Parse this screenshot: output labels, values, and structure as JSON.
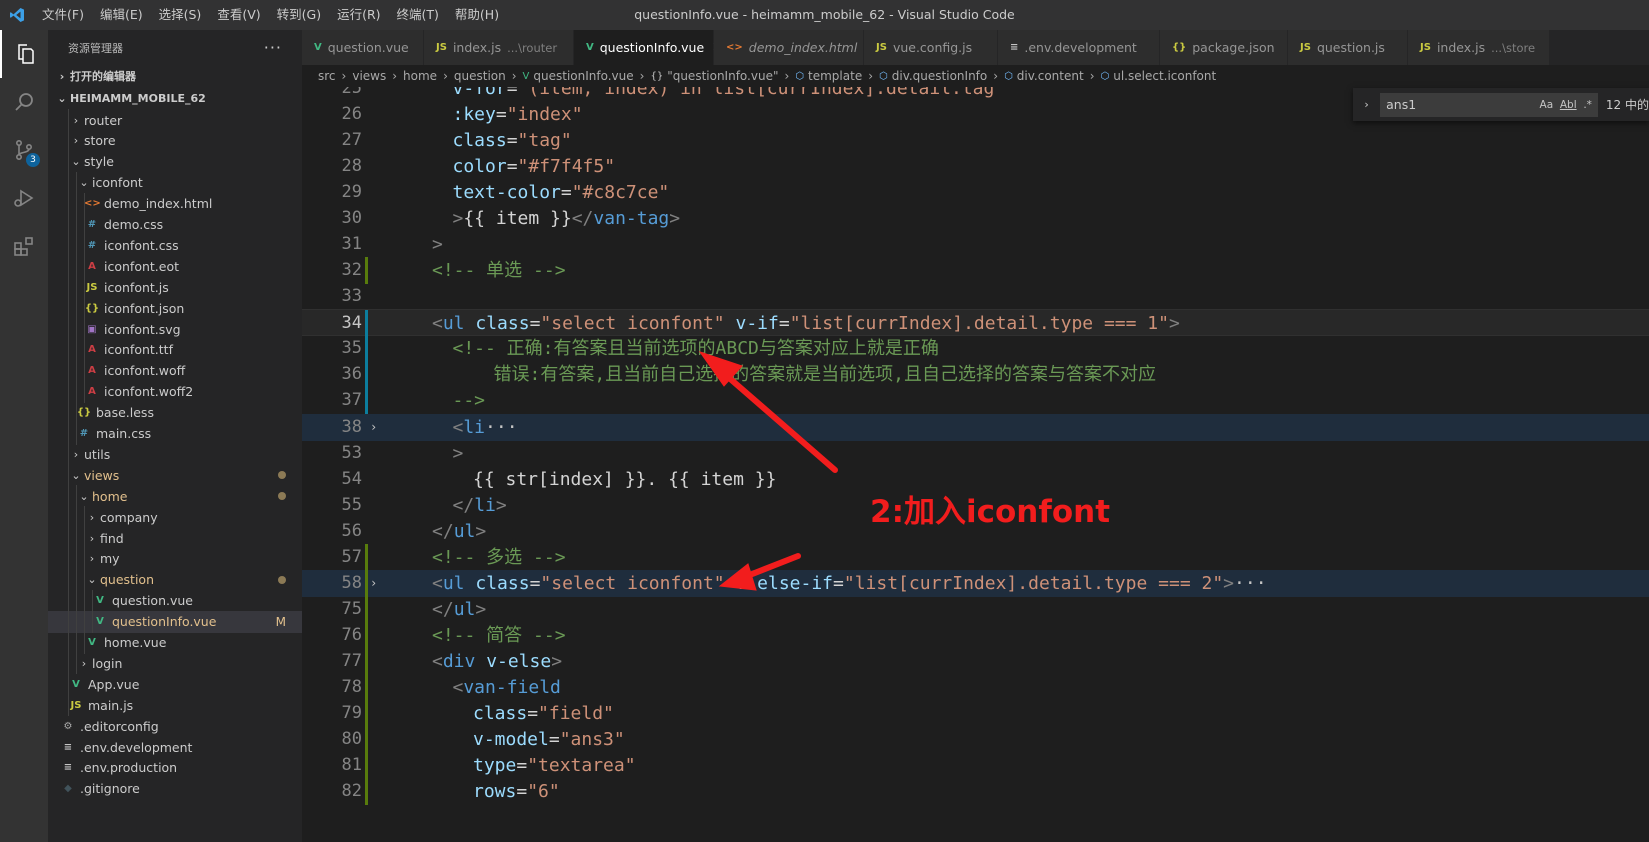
{
  "window": {
    "title": "questionInfo.vue - heimamm_mobile_62 - Visual Studio Code",
    "menu": [
      "文件(F)",
      "编辑(E)",
      "选择(S)",
      "查看(V)",
      "转到(G)",
      "运行(R)",
      "终端(T)",
      "帮助(H)"
    ]
  },
  "activity": {
    "scm_badge": "3"
  },
  "sidebar": {
    "title": "资源管理器",
    "more": "···",
    "open_editors": "打开的编辑器",
    "project": "HEIMAMM_MOBILE_62",
    "items": [
      {
        "label": "router",
        "kind": "folder",
        "depth": 1
      },
      {
        "label": "store",
        "kind": "folder",
        "depth": 1
      },
      {
        "label": "style",
        "kind": "folder-open",
        "depth": 1
      },
      {
        "label": "iconfont",
        "kind": "folder-open",
        "depth": 2
      },
      {
        "label": "demo_index.html",
        "kind": "html",
        "depth": 3
      },
      {
        "label": "demo.css",
        "kind": "css",
        "depth": 3
      },
      {
        "label": "iconfont.css",
        "kind": "css",
        "depth": 3
      },
      {
        "label": "iconfont.eot",
        "kind": "font",
        "depth": 3
      },
      {
        "label": "iconfont.js",
        "kind": "js",
        "depth": 3
      },
      {
        "label": "iconfont.json",
        "kind": "json",
        "depth": 3
      },
      {
        "label": "iconfont.svg",
        "kind": "svg",
        "depth": 3
      },
      {
        "label": "iconfont.ttf",
        "kind": "font",
        "depth": 3
      },
      {
        "label": "iconfont.woff",
        "kind": "font",
        "depth": 3
      },
      {
        "label": "iconfont.woff2",
        "kind": "font",
        "depth": 3
      },
      {
        "label": "base.less",
        "kind": "json",
        "depth": 2
      },
      {
        "label": "main.css",
        "kind": "css",
        "depth": 2
      },
      {
        "label": "utils",
        "kind": "folder",
        "depth": 1
      },
      {
        "label": "views",
        "kind": "folder-open",
        "depth": 1,
        "modified": true
      },
      {
        "label": "home",
        "kind": "folder-open",
        "depth": 2,
        "modified": true
      },
      {
        "label": "company",
        "kind": "folder",
        "depth": 3
      },
      {
        "label": "find",
        "kind": "folder",
        "depth": 3
      },
      {
        "label": "my",
        "kind": "folder",
        "depth": 3
      },
      {
        "label": "question",
        "kind": "folder-open",
        "depth": 3,
        "modified": true
      },
      {
        "label": "question.vue",
        "kind": "vue",
        "depth": 4
      },
      {
        "label": "questionInfo.vue",
        "kind": "vue",
        "depth": 4,
        "modified": true,
        "selected": true,
        "flag": "M"
      },
      {
        "label": "home.vue",
        "kind": "vue",
        "depth": 3
      },
      {
        "label": "login",
        "kind": "folder",
        "depth": 2
      },
      {
        "label": "App.vue",
        "kind": "vue",
        "depth": 1
      },
      {
        "label": "main.js",
        "kind": "js",
        "depth": 1
      },
      {
        "label": ".editorconfig",
        "kind": "gear",
        "depth": 0
      },
      {
        "label": ".env.development",
        "kind": "lines",
        "depth": 0
      },
      {
        "label": ".env.production",
        "kind": "lines",
        "depth": 0
      },
      {
        "label": ".gitignore",
        "kind": "git",
        "depth": 0
      }
    ]
  },
  "tabs": [
    {
      "label": "question.vue",
      "kind": "vue",
      "desc": ""
    },
    {
      "label": "index.js",
      "kind": "js",
      "desc": "...\\router"
    },
    {
      "label": "questionInfo.vue",
      "kind": "vue",
      "desc": "",
      "active": true,
      "close": "✕"
    },
    {
      "label": "demo_index.html",
      "kind": "html",
      "desc": "",
      "italic": true
    },
    {
      "label": "vue.config.js",
      "kind": "js",
      "desc": ""
    },
    {
      "label": ".env.development",
      "kind": "lines",
      "desc": ""
    },
    {
      "label": "package.json",
      "kind": "json",
      "desc": ""
    },
    {
      "label": "question.js",
      "kind": "js",
      "desc": ""
    },
    {
      "label": "index.js",
      "kind": "js",
      "desc": "...\\store"
    }
  ],
  "breadcrumbs": [
    "src",
    "views",
    "home",
    "question",
    "questionInfo.vue",
    "\"questionInfo.vue\"",
    "template",
    "div.questionInfo",
    "div.content",
    "ul.select.iconfont"
  ],
  "find": {
    "value": "ans1",
    "opt_case": "Aa",
    "opt_word": "Abl",
    "opt_regex": ".*",
    "count": "12 中的"
  },
  "editor": {
    "lines": [
      {
        "n": "25",
        "ind": 1,
        "tokens": [
          [
            "at",
            "v-for"
          ],
          [
            "tx",
            "="
          ],
          [
            "st",
            "\"(item, index) in list[currIndex].detail.tag\""
          ]
        ]
      },
      {
        "n": "26",
        "ind": 1,
        "tokens": [
          [
            "at",
            ":key"
          ],
          [
            "tx",
            "="
          ],
          [
            "st",
            "\"index\""
          ]
        ]
      },
      {
        "n": "27",
        "ind": 1,
        "tokens": [
          [
            "at",
            "class"
          ],
          [
            "tx",
            "="
          ],
          [
            "st",
            "\"tag\""
          ]
        ]
      },
      {
        "n": "28",
        "ind": 1,
        "tokens": [
          [
            "at",
            "color"
          ],
          [
            "tx",
            "="
          ],
          [
            "st",
            "\"#f7f4f5\""
          ]
        ]
      },
      {
        "n": "29",
        "ind": 1,
        "tokens": [
          [
            "at",
            "text-color"
          ],
          [
            "tx",
            "="
          ],
          [
            "st",
            "\"#c8c7ce\""
          ]
        ]
      },
      {
        "n": "30",
        "ind": 1,
        "tokens": [
          [
            "br",
            ">"
          ],
          [
            "tx",
            "{{ item }}"
          ],
          [
            "br",
            "</"
          ],
          [
            "tg",
            "van-tag"
          ],
          [
            "br",
            ">"
          ]
        ]
      },
      {
        "n": "31",
        "ind": 0,
        "tokens": [
          [
            "br",
            ">"
          ]
        ]
      },
      {
        "n": "32",
        "ind": 0,
        "tokens": [
          [
            "cm",
            "<!-- 单选 -->"
          ]
        ],
        "gutter": "add"
      },
      {
        "n": "33",
        "ind": 0,
        "tokens": []
      },
      {
        "n": "34",
        "ind": 0,
        "tokens": [
          [
            "br",
            "<"
          ],
          [
            "tg",
            "ul"
          ],
          [
            "tx",
            " "
          ],
          [
            "at",
            "class"
          ],
          [
            "tx",
            "="
          ],
          [
            "st",
            "\"select iconfont\""
          ],
          [
            "tx",
            " "
          ],
          [
            "at",
            "v-if"
          ],
          [
            "tx",
            "="
          ],
          [
            "st",
            "\"list[currIndex].detail.type === 1\""
          ],
          [
            "br",
            ">"
          ]
        ],
        "current": true,
        "gutter": "mod"
      },
      {
        "n": "35",
        "ind": 1,
        "tokens": [
          [
            "cm",
            "<!-- 正确:有答案且当前选项的ABCD与答案对应上就是正确"
          ]
        ],
        "gutter": "mod"
      },
      {
        "n": "36",
        "ind": 3,
        "tokens": [
          [
            "cm",
            "错误:有答案,且当前自己选择的答案就是当前选项,且自己选择的答案与答案不对应"
          ]
        ],
        "gutter": "mod"
      },
      {
        "n": "37",
        "ind": 1,
        "tokens": [
          [
            "cm",
            "-->"
          ]
        ],
        "gutter": "mod"
      },
      {
        "n": "38",
        "ind": 1,
        "tokens": [
          [
            "br",
            "<"
          ],
          [
            "tg",
            "li"
          ],
          [
            "el",
            "···"
          ]
        ],
        "folded": true,
        "highlight": true
      },
      {
        "n": "53",
        "ind": 1,
        "tokens": [
          [
            "br",
            ">"
          ]
        ]
      },
      {
        "n": "54",
        "ind": 2,
        "tokens": [
          [
            "tx",
            "{{ str[index] }}. {{ item }}"
          ]
        ]
      },
      {
        "n": "55",
        "ind": 1,
        "tokens": [
          [
            "br",
            "</"
          ],
          [
            "tg",
            "li"
          ],
          [
            "br",
            ">"
          ]
        ]
      },
      {
        "n": "56",
        "ind": 0,
        "tokens": [
          [
            "br",
            "</"
          ],
          [
            "tg",
            "ul"
          ],
          [
            "br",
            ">"
          ]
        ]
      },
      {
        "n": "57",
        "ind": 0,
        "tokens": [
          [
            "cm",
            "<!-- 多选 -->"
          ]
        ],
        "gutter": "add"
      },
      {
        "n": "58",
        "ind": 0,
        "tokens": [
          [
            "br",
            "<"
          ],
          [
            "tg",
            "ul"
          ],
          [
            "tx",
            " "
          ],
          [
            "at",
            "class"
          ],
          [
            "tx",
            "="
          ],
          [
            "st",
            "\"select iconfont\""
          ],
          [
            "tx",
            " "
          ],
          [
            "at",
            "v-else-if"
          ],
          [
            "tx",
            "="
          ],
          [
            "st",
            "\"list[currIndex].detail.type === 2\""
          ],
          [
            "br",
            ">"
          ],
          [
            "el",
            "···"
          ]
        ],
        "folded": true,
        "highlight": true,
        "gutter": "add"
      },
      {
        "n": "75",
        "ind": 0,
        "tokens": [
          [
            "br",
            "</"
          ],
          [
            "tg",
            "ul"
          ],
          [
            "br",
            ">"
          ]
        ],
        "gutter": "add"
      },
      {
        "n": "76",
        "ind": 0,
        "tokens": [
          [
            "cm",
            "<!-- 简答 -->"
          ]
        ],
        "gutter": "add"
      },
      {
        "n": "77",
        "ind": 0,
        "tokens": [
          [
            "br",
            "<"
          ],
          [
            "tg",
            "div"
          ],
          [
            "tx",
            " "
          ],
          [
            "at",
            "v-else"
          ],
          [
            "br",
            ">"
          ]
        ],
        "gutter": "add"
      },
      {
        "n": "78",
        "ind": 1,
        "tokens": [
          [
            "br",
            "<"
          ],
          [
            "tg",
            "van-field"
          ]
        ],
        "gutter": "add"
      },
      {
        "n": "79",
        "ind": 2,
        "tokens": [
          [
            "at",
            "class"
          ],
          [
            "tx",
            "="
          ],
          [
            "st",
            "\"field\""
          ]
        ],
        "gutter": "add"
      },
      {
        "n": "80",
        "ind": 2,
        "tokens": [
          [
            "at",
            "v-model"
          ],
          [
            "tx",
            "="
          ],
          [
            "st",
            "\"ans3\""
          ]
        ],
        "gutter": "add"
      },
      {
        "n": "81",
        "ind": 2,
        "tokens": [
          [
            "at",
            "type"
          ],
          [
            "tx",
            "="
          ],
          [
            "st",
            "\"textarea\""
          ]
        ],
        "gutter": "add"
      },
      {
        "n": "82",
        "ind": 2,
        "tokens": [
          [
            "at",
            "rows"
          ],
          [
            "tx",
            "="
          ],
          [
            "st",
            "\"6\""
          ]
        ],
        "gutter": "add"
      }
    ]
  },
  "annotation": {
    "text": "2:加入iconfont",
    "color": "#f21d1d"
  }
}
